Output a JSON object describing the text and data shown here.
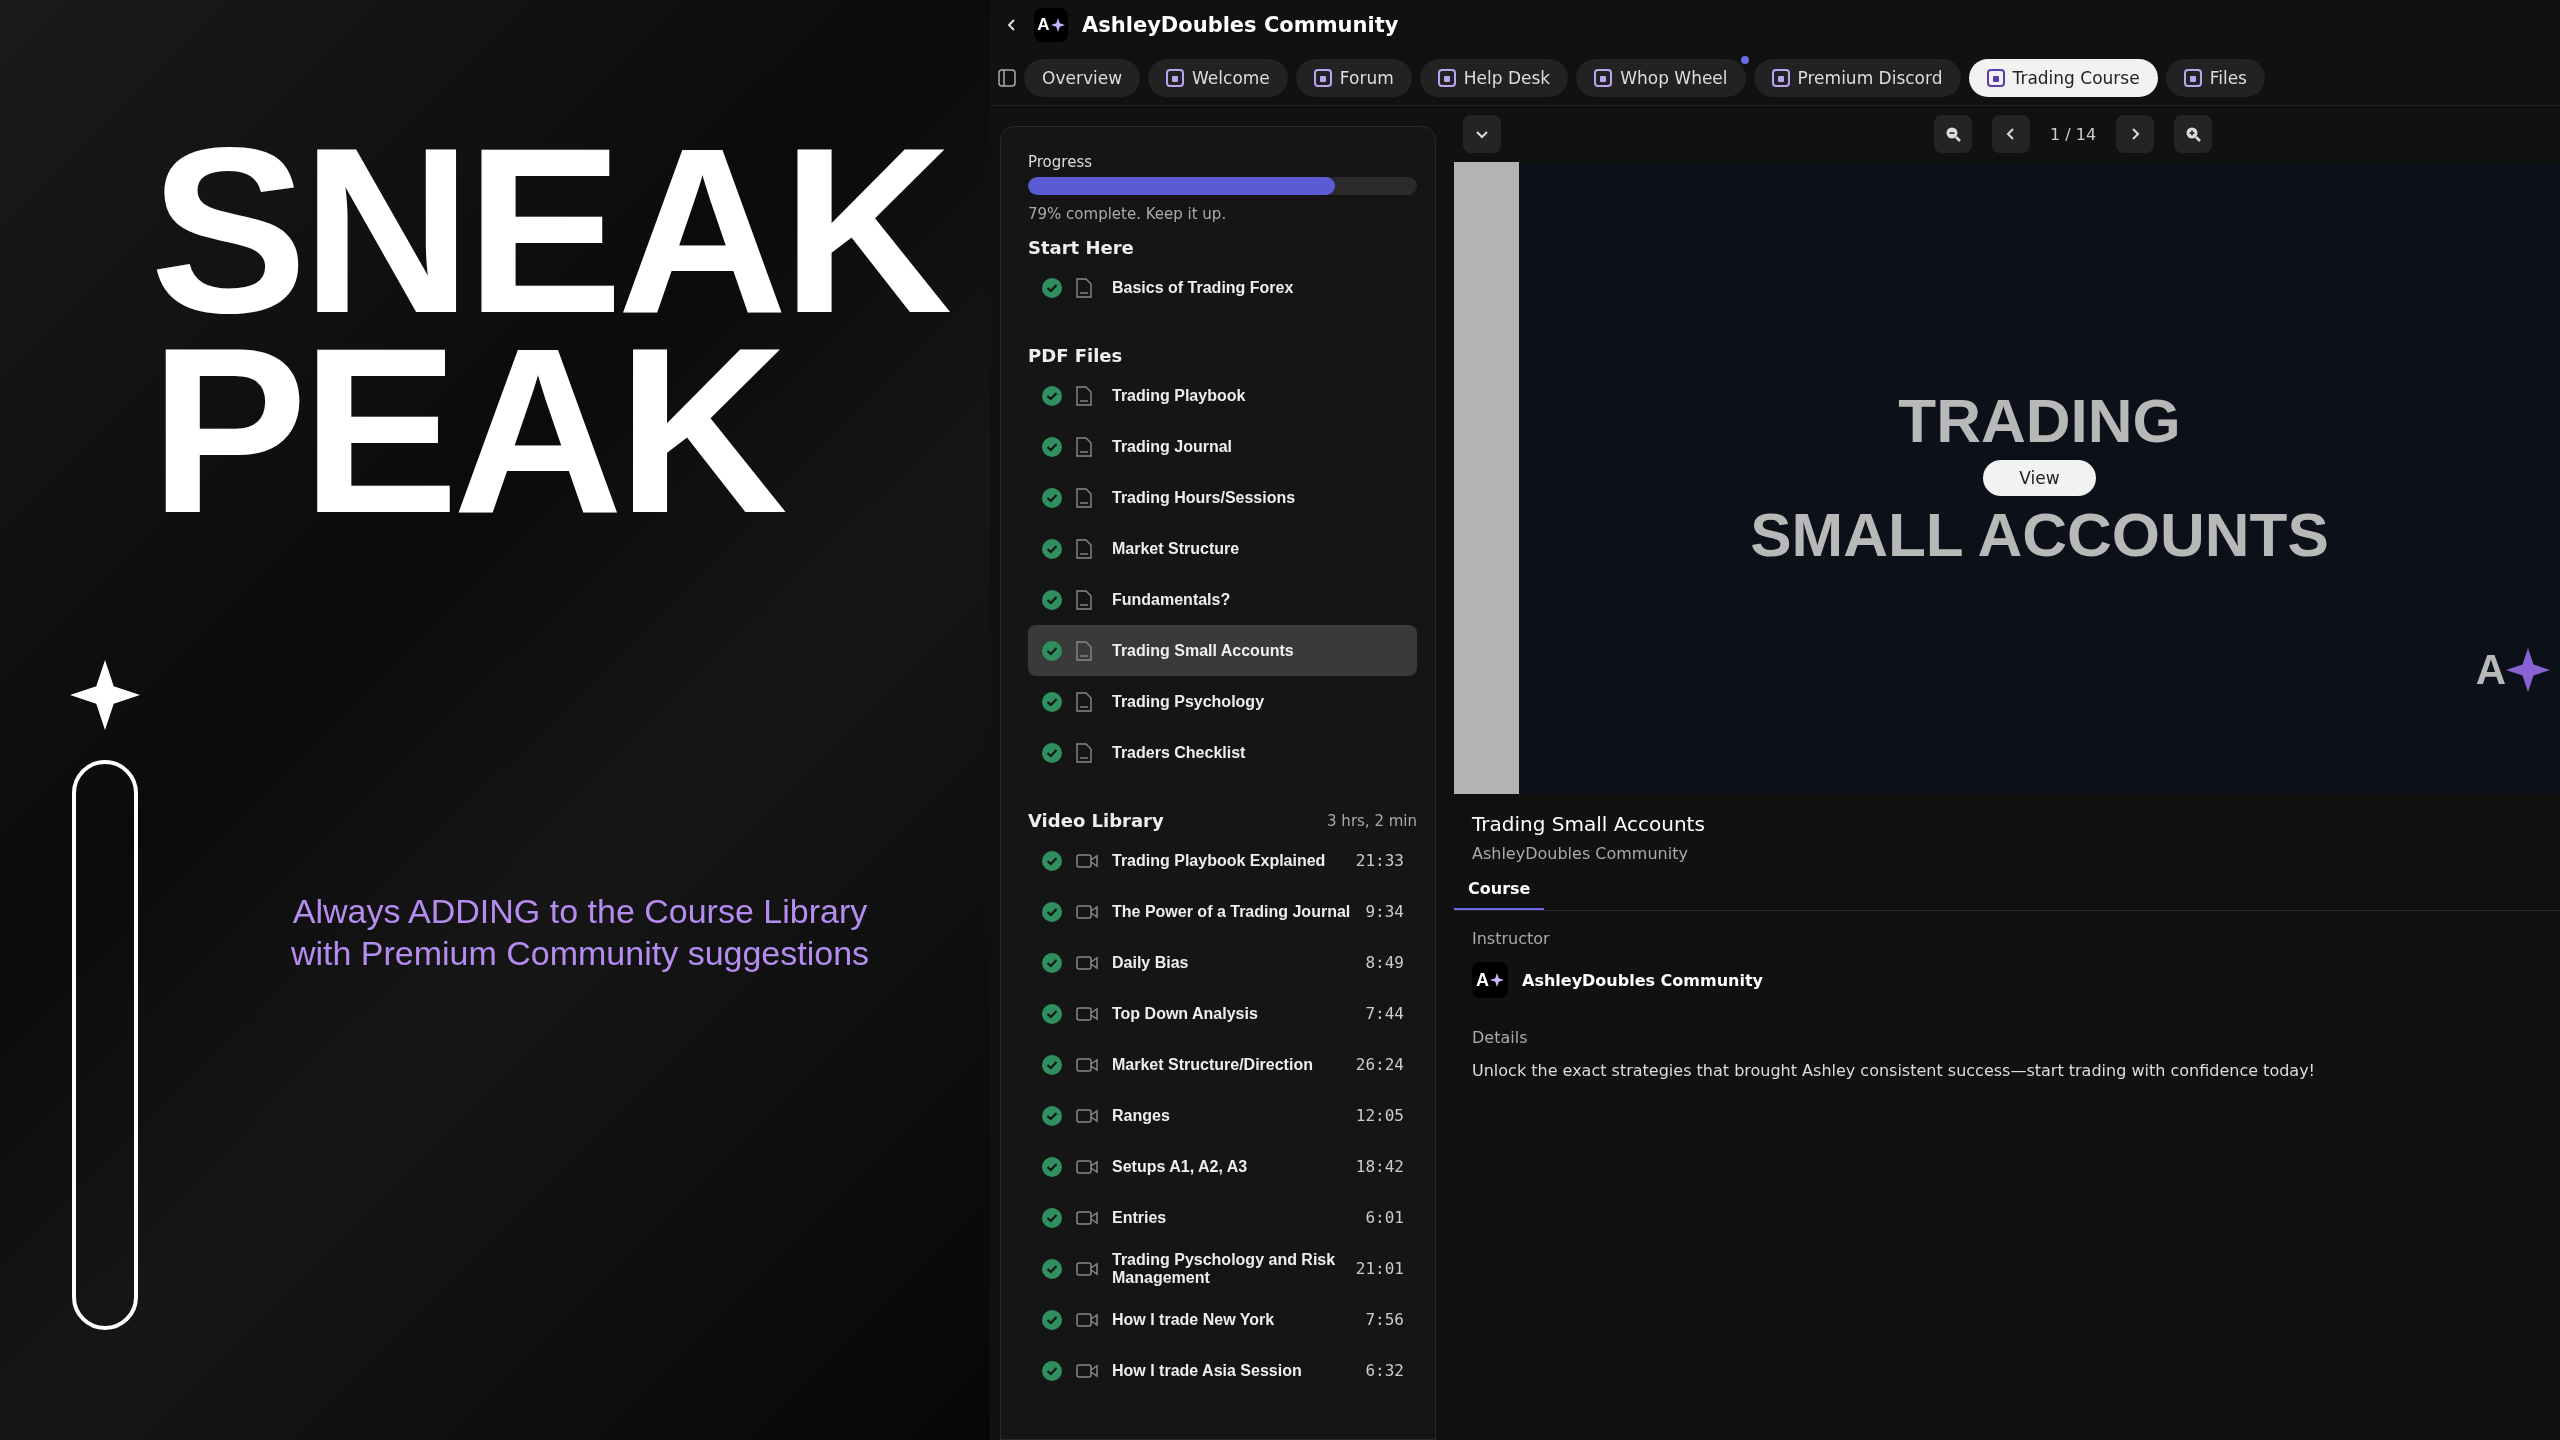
{
  "promo": {
    "headline": [
      "SNEAK",
      "PEAK"
    ],
    "tagline": [
      "Always ADDING to the Course Library",
      "with Premium Community suggestions"
    ]
  },
  "header": {
    "logo_text": "A",
    "title": "AshleyDoubles Community"
  },
  "tabs": [
    {
      "label": "Overview",
      "kind": "plain",
      "selected": false,
      "unread": false
    },
    {
      "label": "Welcome",
      "kind": "app",
      "selected": false,
      "unread": false
    },
    {
      "label": "Forum",
      "kind": "app",
      "selected": false,
      "unread": false
    },
    {
      "label": "Help Desk",
      "kind": "app",
      "selected": false,
      "unread": false
    },
    {
      "label": "Whop Wheel",
      "kind": "app",
      "selected": false,
      "unread": true
    },
    {
      "label": "Premium Discord",
      "kind": "app",
      "selected": false,
      "unread": false
    },
    {
      "label": "Trading Course",
      "kind": "app",
      "selected": true,
      "unread": false
    },
    {
      "label": "Files",
      "kind": "app",
      "selected": false,
      "unread": false
    }
  ],
  "sidebar": {
    "progress": {
      "label": "Progress",
      "level": 0.79,
      "caption": "79% complete. Keep it up."
    },
    "sections": [
      {
        "title": "Start Here",
        "items": [
          {
            "kind": "pdf",
            "title": "Basics of Trading Forex",
            "completed": true,
            "selected": false
          }
        ]
      },
      {
        "title": "PDF Files",
        "items": [
          {
            "kind": "pdf",
            "title": "Trading Playbook",
            "completed": true,
            "selected": false
          },
          {
            "kind": "pdf",
            "title": "Trading Journal",
            "completed": true,
            "selected": false
          },
          {
            "kind": "pdf",
            "title": "Trading Hours/Sessions",
            "completed": true,
            "selected": false
          },
          {
            "kind": "pdf",
            "title": "Market Structure",
            "completed": true,
            "selected": false
          },
          {
            "kind": "pdf",
            "title": "Fundamentals?",
            "completed": true,
            "selected": false
          },
          {
            "kind": "pdf",
            "title": "Trading Small Accounts",
            "completed": true,
            "selected": true
          },
          {
            "kind": "pdf",
            "title": "Trading Psychology",
            "completed": true,
            "selected": false
          },
          {
            "kind": "pdf",
            "title": "Traders Checklist",
            "completed": true,
            "selected": false
          }
        ]
      },
      {
        "title": "Video Library",
        "meta": "3 hrs, 2 min",
        "items": [
          {
            "kind": "video",
            "title": "Trading Playbook Explained",
            "duration": "21:33",
            "completed": true,
            "selected": false
          },
          {
            "kind": "video",
            "title": "The Power of a Trading Journal",
            "duration": "9:34",
            "completed": true,
            "selected": false
          },
          {
            "kind": "video",
            "title": "Daily Bias",
            "duration": "8:49",
            "completed": true,
            "selected": false
          },
          {
            "kind": "video",
            "title": "Top Down Analysis",
            "duration": "7:44",
            "completed": true,
            "selected": false
          },
          {
            "kind": "video",
            "title": "Market Structure/Direction",
            "duration": "26:24",
            "completed": true,
            "selected": false
          },
          {
            "kind": "video",
            "title": "Ranges",
            "duration": "12:05",
            "completed": true,
            "selected": false
          },
          {
            "kind": "video",
            "title": "Setups A1, A2, A3",
            "duration": "18:42",
            "completed": true,
            "selected": false
          },
          {
            "kind": "video",
            "title": "Entries",
            "duration": "6:01",
            "completed": true,
            "selected": false
          },
          {
            "kind": "video",
            "title": "Trading Pyschology and Risk Management",
            "duration": "21:01",
            "completed": true,
            "selected": false
          },
          {
            "kind": "video",
            "title": "How I trade New York",
            "duration": "7:56",
            "completed": true,
            "selected": false
          },
          {
            "kind": "video",
            "title": "How I trade Asia Session",
            "duration": "6:32",
            "completed": true,
            "selected": false
          }
        ]
      }
    ]
  },
  "viewer": {
    "page": "1 / 14",
    "slide_lines": [
      "TRADING",
      "SMALL ACCOUNTS"
    ],
    "view_button": "View",
    "slide_logo_text": "A"
  },
  "details": {
    "title": "Trading Small Accounts",
    "subtitle": "AshleyDoubles Community",
    "tabs": [
      {
        "label": "Course",
        "selected": true
      }
    ],
    "instructor_label": "Instructor",
    "instructor_logo_text": "A",
    "instructor_name": "AshleyDoubles Community",
    "details_label": "Details",
    "description": "Unlock the exact strategies that brought Ashley consistent success—start trading with confidence today!"
  }
}
